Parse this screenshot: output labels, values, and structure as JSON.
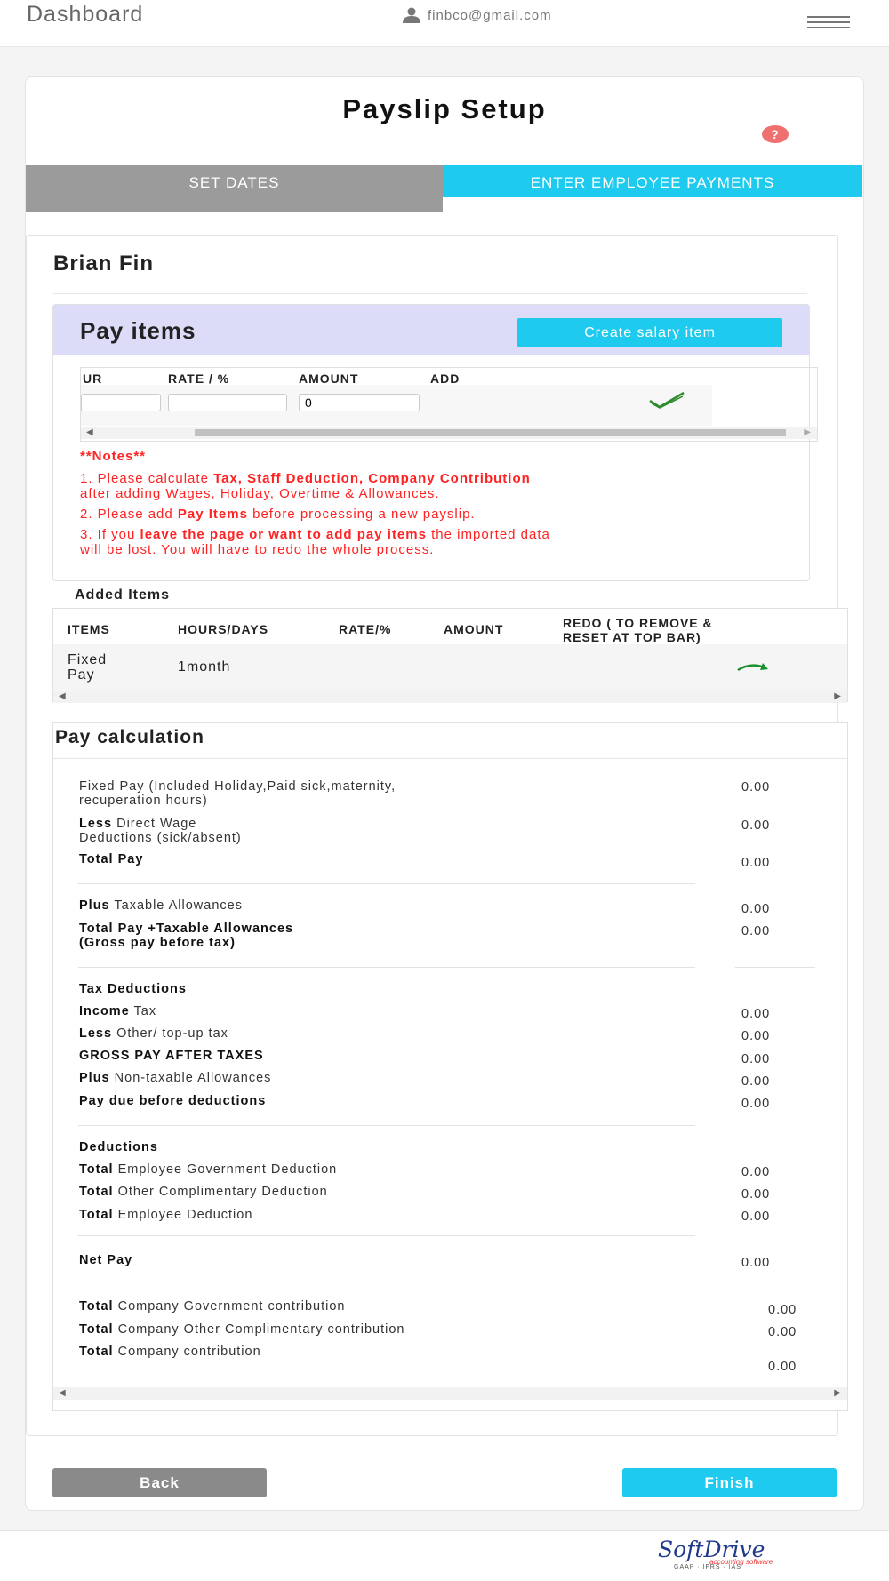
{
  "header": {
    "title": "Dashboard",
    "user_email": "finbco@gmail.com",
    "user_icon": "person-icon",
    "menu_icon": "hamburger-icon"
  },
  "page": {
    "title": "Payslip Setup",
    "help_icon": "question-icon",
    "tabs": [
      "SET DATES",
      "ENTER EMPLOYEE PAYMENTS"
    ]
  },
  "employee": {
    "name": "Brian Fin"
  },
  "pay_items": {
    "title": "Pay items",
    "create_button": "Create salary item",
    "columns": [
      "UR",
      "RATE / %",
      "AMOUNT",
      "ADD"
    ],
    "inputs": {
      "hours": "",
      "rate": "",
      "amount": "0"
    },
    "add_icon": "check-icon"
  },
  "notes": {
    "heading": "**Notes**",
    "n1_a": "1. Please calculate ",
    "n1_b": "Tax, Staff Deduction, Company Contribution",
    "n1_c": "after adding Wages, Holiday, Overtime & Allowances.",
    "n2_a": "2. Please add ",
    "n2_b": "Pay Items",
    "n2_c": " before processing a new payslip.",
    "n3_a": "3. If you ",
    "n3_b": "leave the page or want to add pay items",
    "n3_c": " the imported data",
    "n3_d": "will be lost. You will have to redo the whole process."
  },
  "added_items": {
    "label": "Added Items",
    "columns": [
      "ITEMS",
      "HOURS/DAYS",
      "RATE/%",
      "AMOUNT",
      "REDO ( TO REMOVE &",
      "RESET AT TOP BAR)"
    ],
    "rows": [
      {
        "item_1": "Fixed",
        "item_2": "Pay",
        "hours": "1month",
        "rate": "",
        "amount": "",
        "redo_icon": "redo-arrow-icon"
      }
    ]
  },
  "pay_calculation": {
    "title": "Pay calculation",
    "fixed_pay_1": "Fixed Pay (Included Holiday,Paid sick,maternity,",
    "fixed_pay_2": "recuperation hours)",
    "fixed_pay_val": "0.00",
    "less_b": "Less",
    "less_1": " Direct Wage",
    "less_2": "Deductions (sick/absent)",
    "less_val": "0.00",
    "total_pay": "Total Pay",
    "total_pay_val": "0.00",
    "plus_b": "Plus",
    "plus_t": " Taxable Allowances",
    "plus_val": "0.00",
    "gross_1": "Total Pay +Taxable Allowances",
    "gross_2": "(Gross pay before tax)",
    "gross_val": "0.00",
    "tax_head": "Tax Deductions",
    "income_b": "Income",
    "income_t": " Tax",
    "income_val": "0.00",
    "less_other_b": "Less",
    "less_other_t": " Other/ top-up tax",
    "less_other_val": "0.00",
    "gross_after": "GROSS PAY AFTER TAXES",
    "gross_after_val": "0.00",
    "nontax_b": "Plus",
    "nontax_t": " Non-taxable Allowances",
    "nontax_val": "0.00",
    "pay_due": "Pay due before deductions",
    "pay_due_val": "0.00",
    "ded_head": "Deductions",
    "ded1_b": "Total",
    "ded1_t": " Employee Government Deduction",
    "ded1_val": "0.00",
    "ded2_b": "Total",
    "ded2_t": " Other Complimentary Deduction",
    "ded2_val": "0.00",
    "ded3_b": "Total",
    "ded3_t": " Employee Deduction",
    "ded3_val": "0.00",
    "net_pay": "Net Pay",
    "net_pay_val": "0.00",
    "comp1_b": "Total",
    "comp1_t": " Company Government contribution",
    "comp1_val": "0.00",
    "comp2_b": "Total",
    "comp2_t": " Company Other Complimentary contribution",
    "comp2_val": "0.00",
    "comp3_b": "Total",
    "comp3_t": " Company contribution",
    "comp3_val": "0.00"
  },
  "actions": {
    "back": "Back",
    "finish": "Finish"
  },
  "footer": {
    "logo_text": "SoftDrive",
    "logo_tagline": "accounting software",
    "logo_sub": "GAAP · IFRS · IAS"
  },
  "colors": {
    "accent": "#1ecbef",
    "tab_inactive": "#9b9b9b",
    "notes_red": "#ff2222",
    "pay_items_header": "#dcdcf8"
  }
}
